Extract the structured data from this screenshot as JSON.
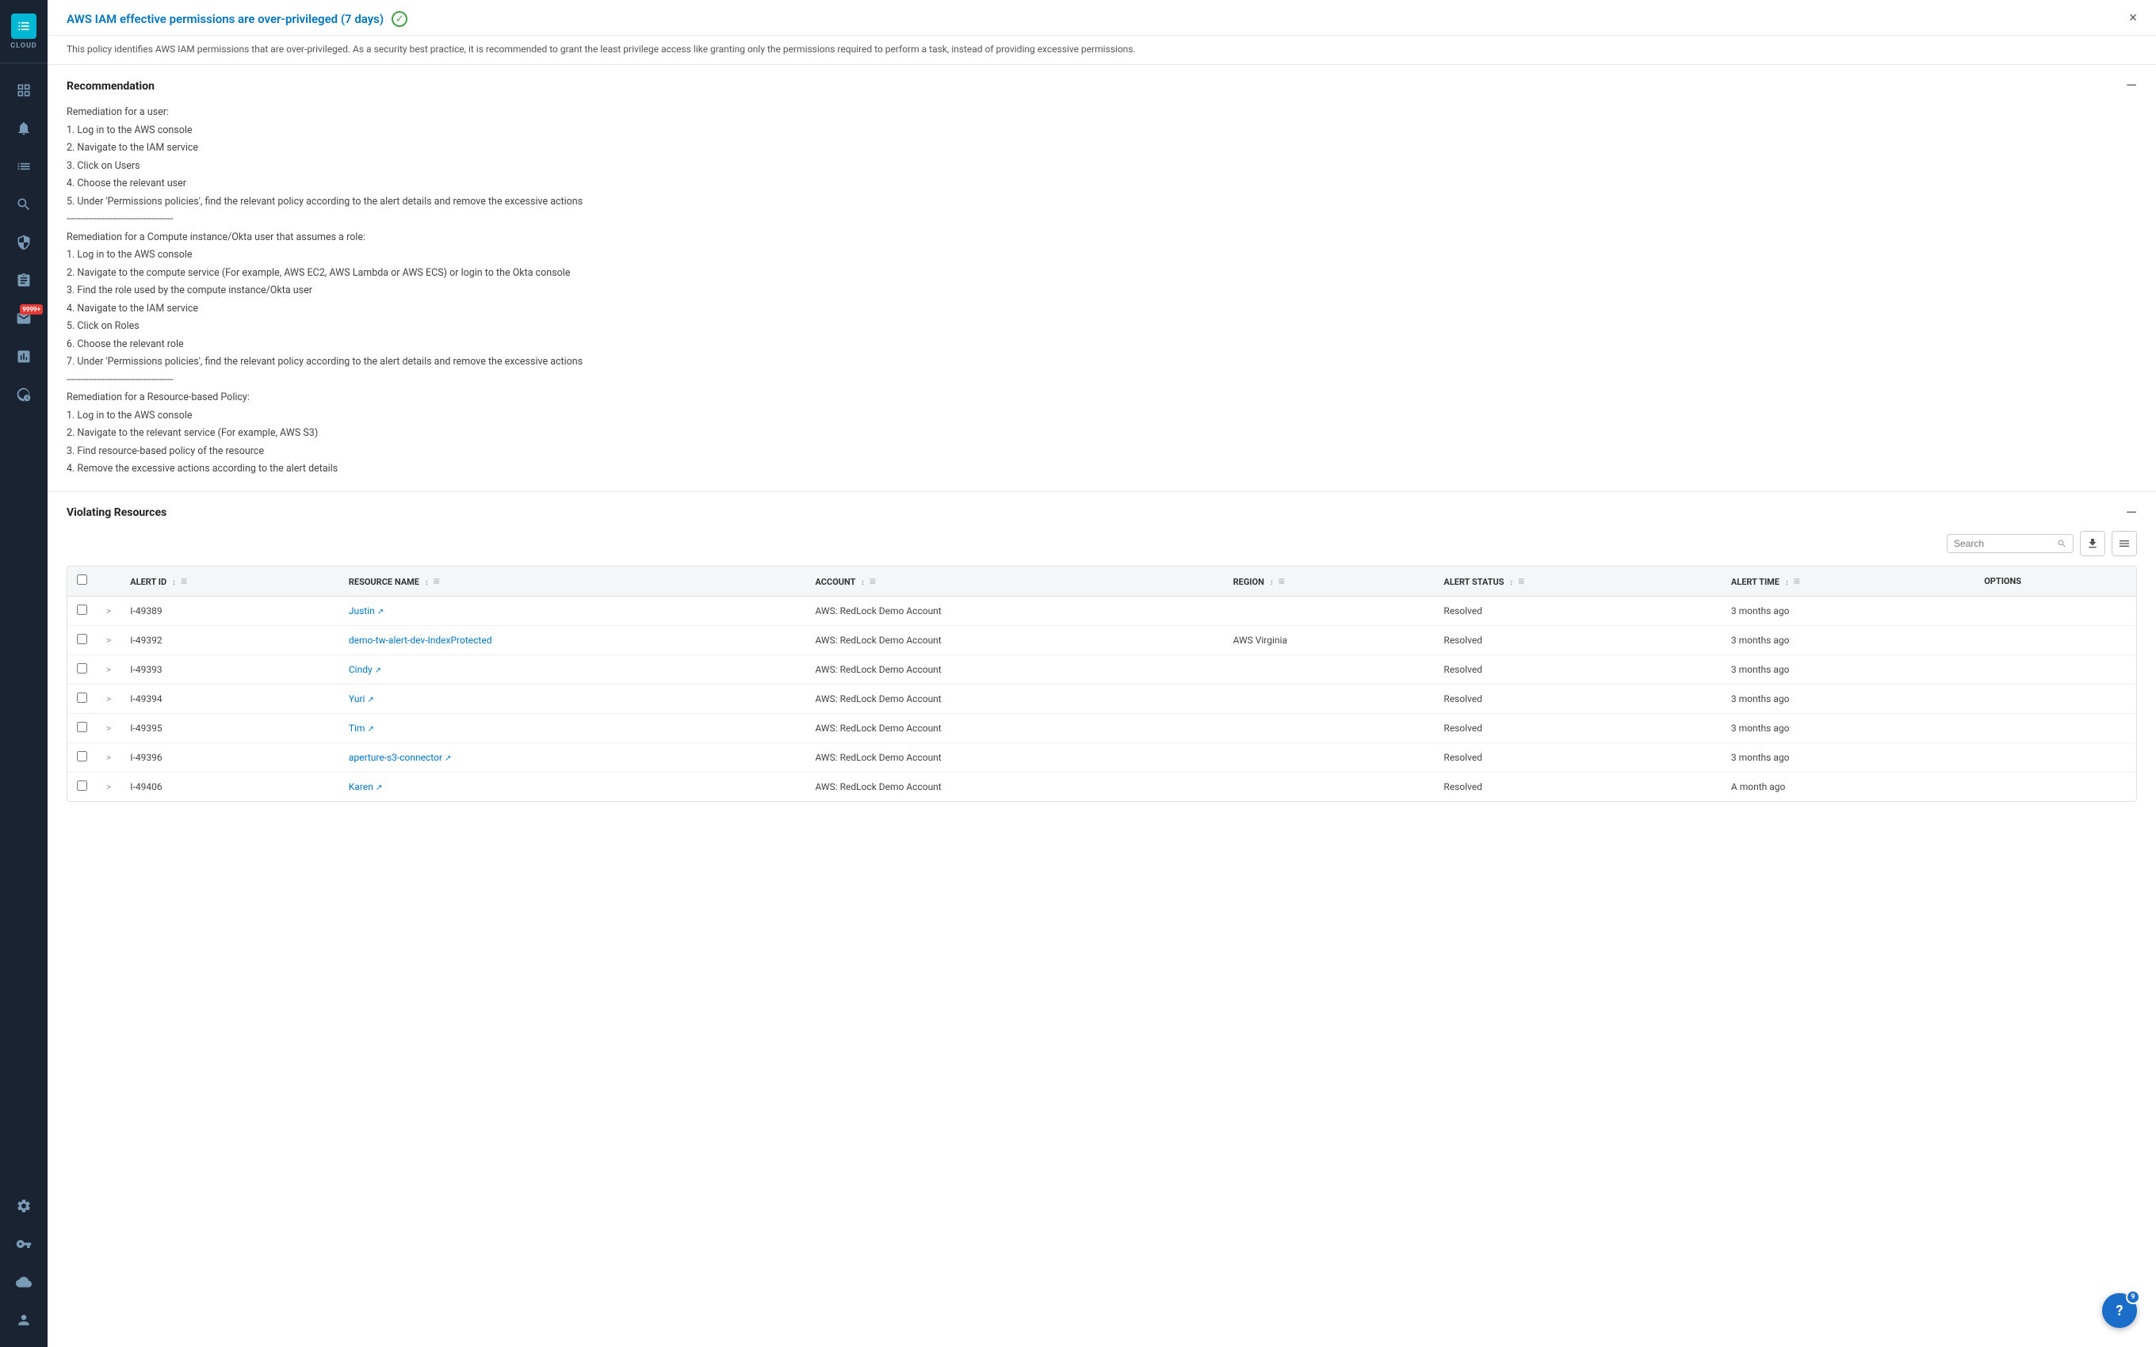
{
  "sidebar": {
    "logo_text": "CLOUD",
    "badge_text": "9999+",
    "items": [
      {
        "id": "dashboard",
        "icon": "grid",
        "active": false
      },
      {
        "id": "alerts",
        "icon": "bell",
        "active": false
      },
      {
        "id": "list",
        "icon": "list",
        "active": false
      },
      {
        "id": "search",
        "icon": "search",
        "active": false
      },
      {
        "id": "shield",
        "icon": "shield",
        "active": false
      },
      {
        "id": "clipboard",
        "icon": "clipboard",
        "active": false
      },
      {
        "id": "notifications",
        "icon": "notifications",
        "active": false,
        "badge": true
      },
      {
        "id": "chart",
        "icon": "chart",
        "active": false
      },
      {
        "id": "network",
        "icon": "network",
        "active": false
      }
    ],
    "bottom_items": [
      {
        "id": "settings",
        "icon": "settings"
      },
      {
        "id": "key",
        "icon": "key"
      },
      {
        "id": "cloud-settings",
        "icon": "cloud-settings"
      },
      {
        "id": "user",
        "icon": "user"
      }
    ]
  },
  "header": {
    "title": "AWS IAM effective permissions are over-privileged (7 days)",
    "subtitle": "This policy identifies AWS IAM permissions that are over-privileged. As a security best practice, it is recommended to grant the least privilege access like granting only the permissions required to perform a task, instead of providing excessive permissions.",
    "close_label": "×"
  },
  "recommendation": {
    "title": "Recommendation",
    "collapse_icon": "—",
    "content_lines": [
      "Remediation for a user:",
      "1. Log in to the AWS console",
      "2. Navigate to the IAM service",
      "3. Click on Users",
      "4. Choose the relevant user",
      "5. Under 'Permissions policies', find the relevant policy according to the alert details and remove the excessive actions",
      "---------------------------------------",
      "Remediation for a Compute instance/Okta user that assumes a role:",
      "1. Log in to the AWS console",
      "2. Navigate to the compute service (For example, AWS EC2, AWS Lambda or AWS ECS) or login to the Okta console",
      "3. Find the role used by the compute instance/Okta user",
      "4. Navigate to the IAM service",
      "5. Click on Roles",
      "6. Choose the relevant role",
      "7. Under 'Permissions policies', find the relevant policy according to the alert details and remove the excessive actions",
      "---------------------------------------",
      "Remediation for a Resource-based Policy:",
      "1. Log in to the AWS console",
      "2. Navigate to the relevant service (For example, AWS S3)",
      "3. Find resource-based policy of the resource",
      "4. Remove the excessive actions according to the alert details"
    ]
  },
  "violations": {
    "title": "Violating Resources",
    "collapse_icon": "—",
    "search_placeholder": "Search",
    "columns": [
      {
        "key": "alert_id",
        "label": "ALERT ID"
      },
      {
        "key": "resource_name",
        "label": "RESOURCE NAME"
      },
      {
        "key": "account",
        "label": "ACCOUNT"
      },
      {
        "key": "region",
        "label": "REGION"
      },
      {
        "key": "alert_status",
        "label": "ALERT STATUS"
      },
      {
        "key": "alert_time",
        "label": "ALERT TIME"
      },
      {
        "key": "options",
        "label": "OPTIONS"
      }
    ],
    "rows": [
      {
        "id": "I-49389",
        "resource_name": "Justin",
        "resource_link": true,
        "account": "AWS: RedLock Demo Account",
        "region": "",
        "alert_status": "Resolved",
        "alert_time": "3 months ago"
      },
      {
        "id": "I-49392",
        "resource_name": "demo-tw-alert-dev-IndexProtected",
        "resource_link": false,
        "account": "AWS: RedLock Demo Account",
        "region": "AWS Virginia",
        "alert_status": "Resolved",
        "alert_time": "3 months ago"
      },
      {
        "id": "I-49393",
        "resource_name": "Cindy",
        "resource_link": true,
        "account": "AWS: RedLock Demo Account",
        "region": "",
        "alert_status": "Resolved",
        "alert_time": "3 months ago"
      },
      {
        "id": "I-49394",
        "resource_name": "Yuri",
        "resource_link": true,
        "account": "AWS: RedLock Demo Account",
        "region": "",
        "alert_status": "Resolved",
        "alert_time": "3 months ago"
      },
      {
        "id": "I-49395",
        "resource_name": "Tim",
        "resource_link": true,
        "account": "AWS: RedLock Demo Account",
        "region": "",
        "alert_status": "Resolved",
        "alert_time": "3 months ago"
      },
      {
        "id": "I-49396",
        "resource_name": "aperture-s3-connector",
        "resource_link": true,
        "account": "AWS: RedLock Demo Account",
        "region": "",
        "alert_status": "Resolved",
        "alert_time": "3 months ago"
      },
      {
        "id": "I-49406",
        "resource_name": "Karen",
        "resource_link": true,
        "account": "AWS: RedLock Demo Account",
        "region": "",
        "alert_status": "Resolved",
        "alert_time": "A month ago"
      }
    ]
  },
  "help": {
    "badge": "9",
    "icon": "?"
  }
}
